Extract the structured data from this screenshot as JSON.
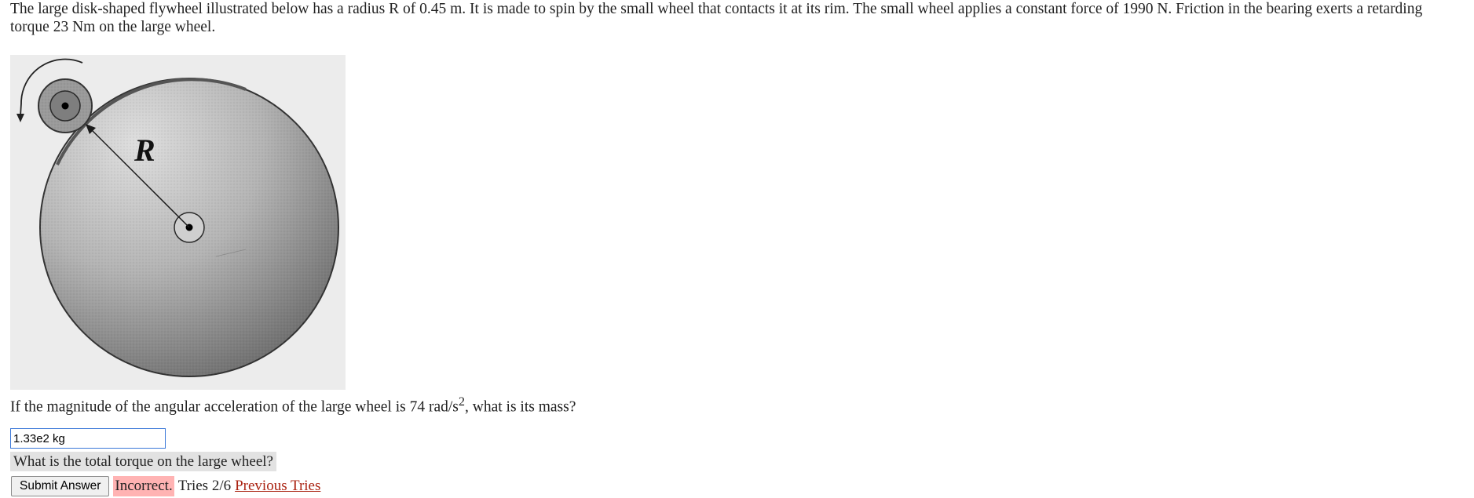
{
  "problem": {
    "text": "The large disk-shaped flywheel illustrated below has a radius R of 0.45 m. It is made to spin by the small wheel that contacts it at its rim. The small wheel applies a constant force of 1990 N. Friction in the bearing exerts a retarding torque 23 Nm on the large wheel."
  },
  "figure": {
    "radius_label": "R"
  },
  "question": {
    "text_before": "If the magnitude of the angular acceleration of the large wheel is 74 rad/s",
    "superscript": "2",
    "text_after": ", what is its mass?"
  },
  "answer": {
    "value": "1.33e2 kg"
  },
  "hint": {
    "text": "What is the total torque on the large wheel?"
  },
  "feedback": {
    "submit_label": "Submit Answer",
    "status": "Incorrect.",
    "tries": "Tries 2/6",
    "previous_tries": "Previous Tries",
    "status_color": "#ffb3b3"
  }
}
